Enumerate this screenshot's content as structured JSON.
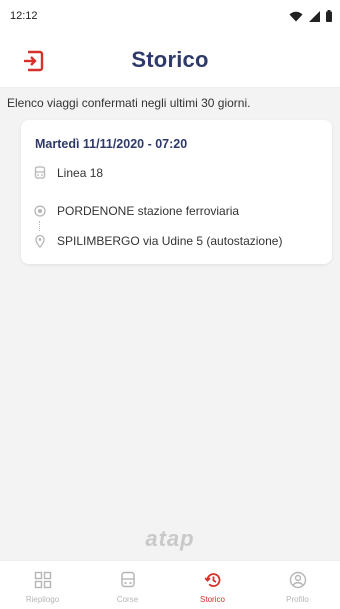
{
  "status": {
    "time": "12:12"
  },
  "header": {
    "title": "Storico"
  },
  "subtitle": "Elenco viaggi confermati negli ultimi 30 giorni.",
  "trip": {
    "date": "Martedì 11/11/2020 - 07:20",
    "line": "Linea 18",
    "from": "PORDENONE stazione ferroviaria",
    "to": "SPILIMBERGO via Udine 5 (autostazione)"
  },
  "brand": "atap",
  "tabs": [
    {
      "label": "Riepilogo",
      "icon": "dashboard-icon",
      "active": false
    },
    {
      "label": "Corse",
      "icon": "bus-icon",
      "active": false
    },
    {
      "label": "Storico",
      "icon": "history-icon",
      "active": true
    },
    {
      "label": "Profilo",
      "icon": "profile-icon",
      "active": false
    }
  ],
  "colors": {
    "accent": "#d8302a",
    "navy": "#2f3a6b",
    "inactive": "#b5b5b5",
    "background": "#f3f3f3"
  }
}
